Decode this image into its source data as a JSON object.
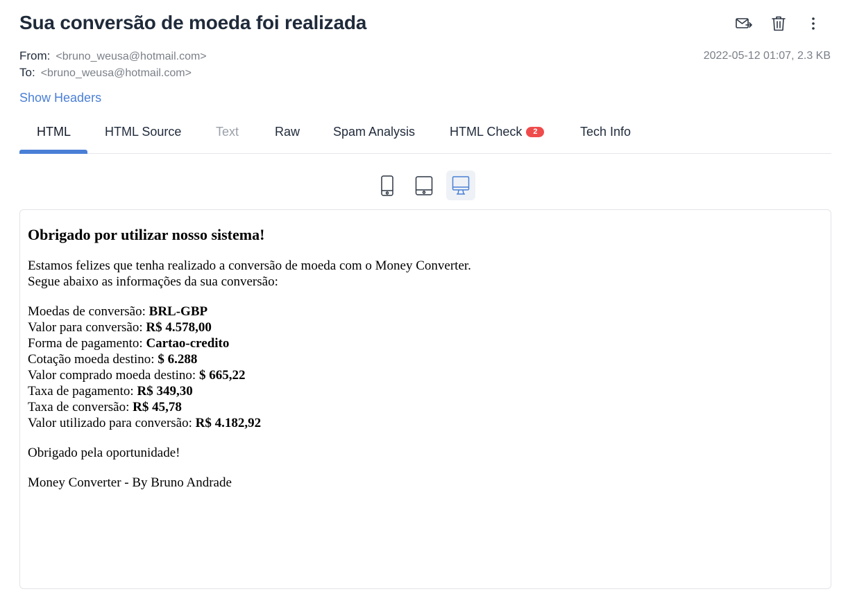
{
  "email": {
    "subject": "Sua conversão de moeda foi realizada",
    "from_label": "From:",
    "from_address": "<bruno_weusa@hotmail.com>",
    "to_label": "To:",
    "to_address": "<bruno_weusa@hotmail.com>",
    "date_size": "2022-05-12 01:07, 2.3 KB",
    "show_headers": "Show Headers"
  },
  "actions": [
    {
      "name": "forward-icon"
    },
    {
      "name": "trash-icon"
    },
    {
      "name": "more-icon"
    }
  ],
  "tabs": [
    {
      "label": "HTML",
      "state": "active"
    },
    {
      "label": "HTML Source",
      "state": "normal"
    },
    {
      "label": "Text",
      "state": "disabled"
    },
    {
      "label": "Raw",
      "state": "normal"
    },
    {
      "label": "Spam Analysis",
      "state": "normal"
    },
    {
      "label": "HTML Check",
      "state": "normal",
      "badge": "2"
    },
    {
      "label": "Tech Info",
      "state": "normal"
    }
  ],
  "devices": [
    {
      "name": "mobile-icon",
      "active": false
    },
    {
      "name": "tablet-icon",
      "active": false
    },
    {
      "name": "desktop-icon",
      "active": true
    }
  ],
  "body": {
    "heading": "Obrigado por utilizar nosso sistema!",
    "intro_1": "Estamos felizes que tenha realizado a conversão de moeda com o Money Converter.",
    "intro_2": "Segue abaixo as informações da sua conversão:",
    "details": [
      {
        "label": "Moedas de conversão: ",
        "value": "BRL-GBP"
      },
      {
        "label": "Valor para conversão: ",
        "value": "R$ 4.578,00"
      },
      {
        "label": "Forma de pagamento: ",
        "value": "Cartao-credito"
      },
      {
        "label": "Cotação moeda destino: ",
        "value": "$ 6.288"
      },
      {
        "label": "Valor comprado moeda destino: ",
        "value": "$ 665,22"
      },
      {
        "label": "Taxa de pagamento: ",
        "value": "R$ 349,30"
      },
      {
        "label": "Taxa de conversão: ",
        "value": "R$ 45,78"
      },
      {
        "label": "Valor utilizado para conversão: ",
        "value": "R$ 4.182,92"
      }
    ],
    "thanks": "Obrigado pela oportunidade!",
    "signature": "Money Converter - By Bruno Andrade"
  },
  "colors": {
    "accent": "#4a7fd6",
    "badge": "#ef4b4b"
  }
}
